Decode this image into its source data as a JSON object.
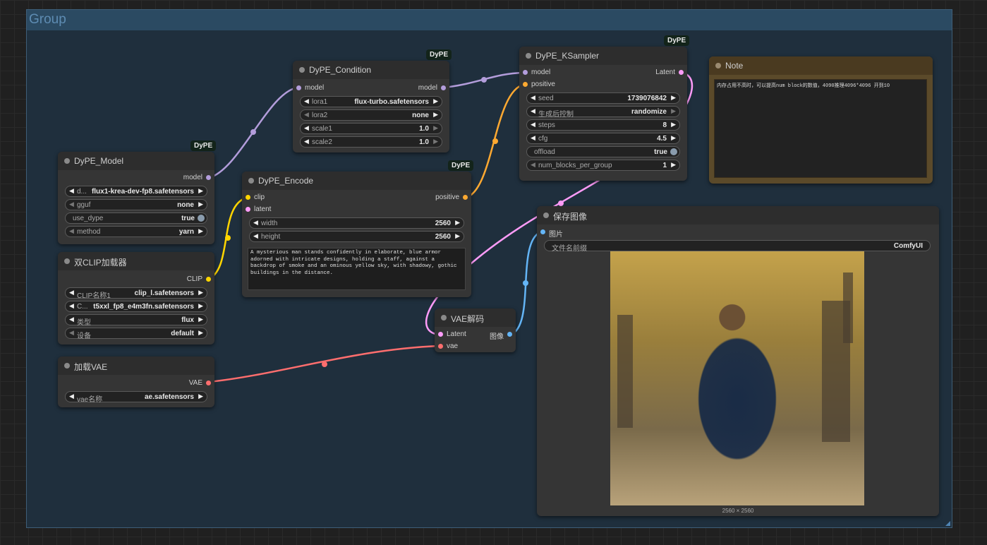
{
  "group": {
    "title": "Group"
  },
  "badges": {
    "dype": "DyPE"
  },
  "nodes": {
    "dype_model": {
      "title": "DyPE_Model",
      "outputs": {
        "model": "model"
      },
      "widgets": [
        {
          "label": "d...",
          "value": "flux1-krea-dev-fp8.safetensors"
        },
        {
          "label": "gguf",
          "value": "none"
        },
        {
          "label": "use_dype",
          "value": "true"
        },
        {
          "label": "method",
          "value": "yarn"
        }
      ]
    },
    "dual_clip": {
      "title": "双CLIP加载器",
      "outputs": {
        "clip": "CLIP"
      },
      "widgets": [
        {
          "label": "CLIP名称1",
          "value": "clip_l.safetensors"
        },
        {
          "label": "C...",
          "value": "t5xxl_fp8_e4m3fn.safetensors"
        },
        {
          "label": "类型",
          "value": "flux"
        },
        {
          "label": "设备",
          "value": "default"
        }
      ]
    },
    "load_vae": {
      "title": "加载VAE",
      "outputs": {
        "vae": "VAE"
      },
      "widgets": [
        {
          "label": "vae名称",
          "value": "ae.safetensors"
        }
      ]
    },
    "dype_condition": {
      "title": "DyPE_Condition",
      "inputs": {
        "model": "model"
      },
      "outputs": {
        "model": "model"
      },
      "widgets": [
        {
          "label": "lora1",
          "value": "flux-turbo.safetensors"
        },
        {
          "label": "lora2",
          "value": "none"
        },
        {
          "label": "scale1",
          "value": "1.0"
        },
        {
          "label": "scale2",
          "value": "1.0"
        }
      ]
    },
    "dype_encode": {
      "title": "DyPE_Encode",
      "inputs": {
        "clip": "clip",
        "latent": "latent"
      },
      "outputs": {
        "positive": "positive"
      },
      "widgets": [
        {
          "label": "width",
          "value": "2560"
        },
        {
          "label": "height",
          "value": "2560"
        }
      ],
      "prompt": "A mysterious man stands confidently in elaborate, blue armor adorned with intricate designs, holding a staff, against a backdrop of smoke and an ominous yellow sky, with shadowy, gothic buildings in the distance."
    },
    "dype_ksampler": {
      "title": "DyPE_KSampler",
      "inputs": {
        "model": "model",
        "positive": "positive"
      },
      "outputs": {
        "latent": "Latent"
      },
      "widgets": [
        {
          "label": "seed",
          "value": "1739076842"
        },
        {
          "label": "生成后控制",
          "value": "randomize"
        },
        {
          "label": "steps",
          "value": "8"
        },
        {
          "label": "cfg",
          "value": "4.5"
        },
        {
          "label": "offload",
          "value": "true"
        },
        {
          "label": "num_blocks_per_group",
          "value": "1"
        }
      ]
    },
    "vae_decode": {
      "title": "VAE解码",
      "inputs": {
        "latent": "Latent",
        "vae": "vae"
      },
      "outputs": {
        "image": "图像"
      }
    },
    "save_image": {
      "title": "保存图像",
      "inputs": {
        "image": "图片"
      },
      "widgets": [
        {
          "label": "文件名前缀",
          "value": "ComfyUI"
        }
      ],
      "caption": "2560 × 2560"
    },
    "note": {
      "title": "Note",
      "text": "内存占用不高时，可以提高num block的数值，4090推理4096*4096 开到10"
    }
  },
  "colors": {
    "model": "#b39ddb",
    "clip": "#ffd500",
    "vae": "#ff6e6e",
    "latent": "#ff9cf9",
    "conditioning": "#ffa931",
    "image": "#64b5f6"
  }
}
